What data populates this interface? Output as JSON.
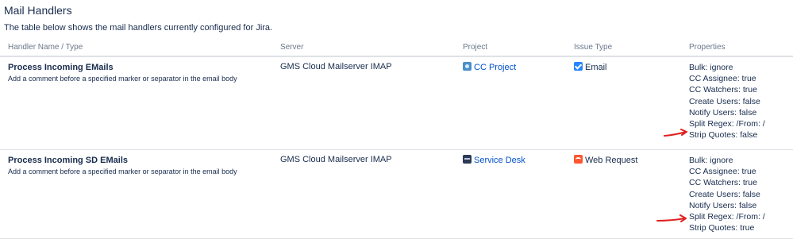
{
  "page": {
    "title": "Mail Handlers",
    "description": "The table below shows the mail handlers currently configured for Jira."
  },
  "columns": [
    "Handler Name / Type",
    "Server",
    "Project",
    "Issue Type",
    "Properties"
  ],
  "rows": [
    {
      "name": "Process Incoming EMails",
      "type_desc": "Add a comment before a specified marker or separator in the email body",
      "server": "GMS Cloud Mailserver IMAP",
      "project": "CC Project",
      "project_icon": "project-avatar-icon",
      "issue_type": "Email",
      "issue_type_icon": "checkbox-icon",
      "properties": [
        "Bulk: ignore",
        "CC Assignee: true",
        "CC Watchers: true",
        "Create Users: false",
        "Notify Users: false",
        "Split Regex: /From: /",
        "Strip Quotes: false"
      ]
    },
    {
      "name": "Process Incoming SD EMails",
      "type_desc": "Add a comment before a specified marker or separator in the email body",
      "server": "GMS Cloud Mailserver IMAP",
      "project": "Service Desk",
      "project_icon": "service-desk-icon",
      "issue_type": "Web Request",
      "issue_type_icon": "web-request-icon",
      "properties": [
        "Bulk: ignore",
        "CC Assignee: true",
        "CC Watchers: true",
        "Create Users: false",
        "Notify Users: false",
        "Split Regex: /From: /",
        "Strip Quotes: true"
      ]
    }
  ],
  "colors": {
    "text": "#172b4d",
    "link": "#0052cc",
    "header_text": "#6b778c",
    "border": "#dfe1e6",
    "annotation_arrow": "#e02020"
  }
}
